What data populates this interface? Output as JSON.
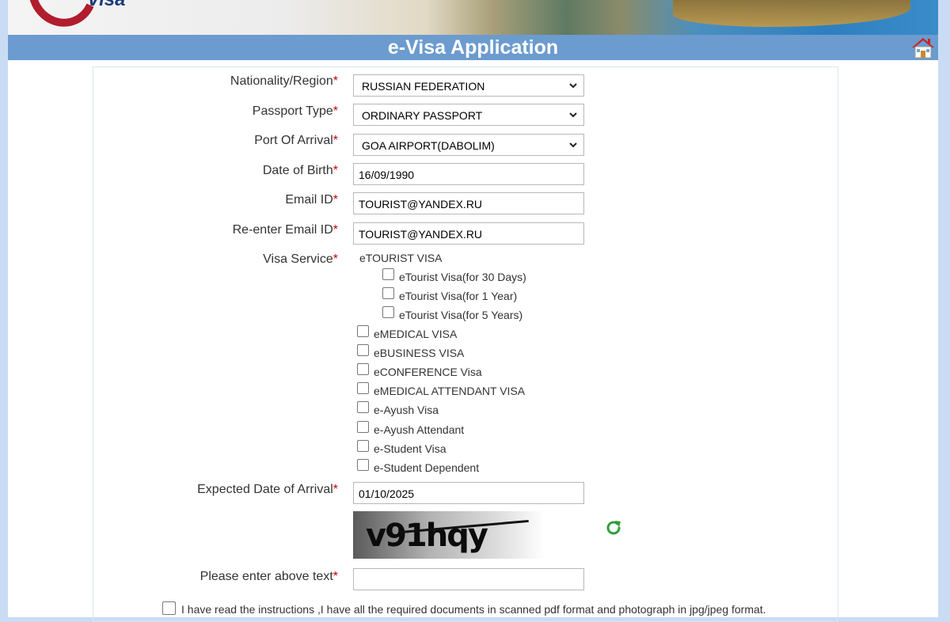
{
  "header": {
    "logo_text": "Visa",
    "title": "e-Visa Application",
    "home_icon": "home-icon"
  },
  "form": {
    "nationality": {
      "label": "Nationality/Region",
      "value": "RUSSIAN FEDERATION"
    },
    "passport_type": {
      "label": "Passport Type",
      "value": "ORDINARY PASSPORT"
    },
    "port_of_arrival": {
      "label": "Port Of Arrival",
      "value": "GOA AIRPORT(DABOLIM)"
    },
    "date_of_birth": {
      "label": "Date of Birth",
      "value": "16/09/1990"
    },
    "email": {
      "label": "Email ID",
      "value": "TOURIST@YANDEX.RU"
    },
    "re_email": {
      "label": "Re-enter Email ID",
      "value": "TOURIST@YANDEX.RU"
    },
    "visa_service": {
      "label": "Visa Service",
      "group_title": "eTOURIST VISA",
      "tourist_options": [
        "eTourist Visa(for 30 Days)",
        "eTourist Visa(for 1 Year)",
        "eTourist Visa(for 5 Years)"
      ],
      "options": [
        "eMEDICAL VISA",
        "eBUSINESS VISA",
        "eCONFERENCE Visa",
        "eMEDICAL ATTENDANT VISA",
        "e-Ayush Visa",
        "e-Ayush Attendant",
        "e-Student Visa",
        "e-Student Dependent"
      ]
    },
    "arrival_date": {
      "label": "Expected Date of Arrival",
      "value": "01/10/2025"
    },
    "captcha": {
      "text": "v91hqy",
      "input_label": "Please enter above text",
      "input_value": ""
    },
    "required_mark": "*",
    "declaration": "I have read the instructions ,I have all the required documents in scanned pdf format and photograph in jpg/jpeg format."
  }
}
